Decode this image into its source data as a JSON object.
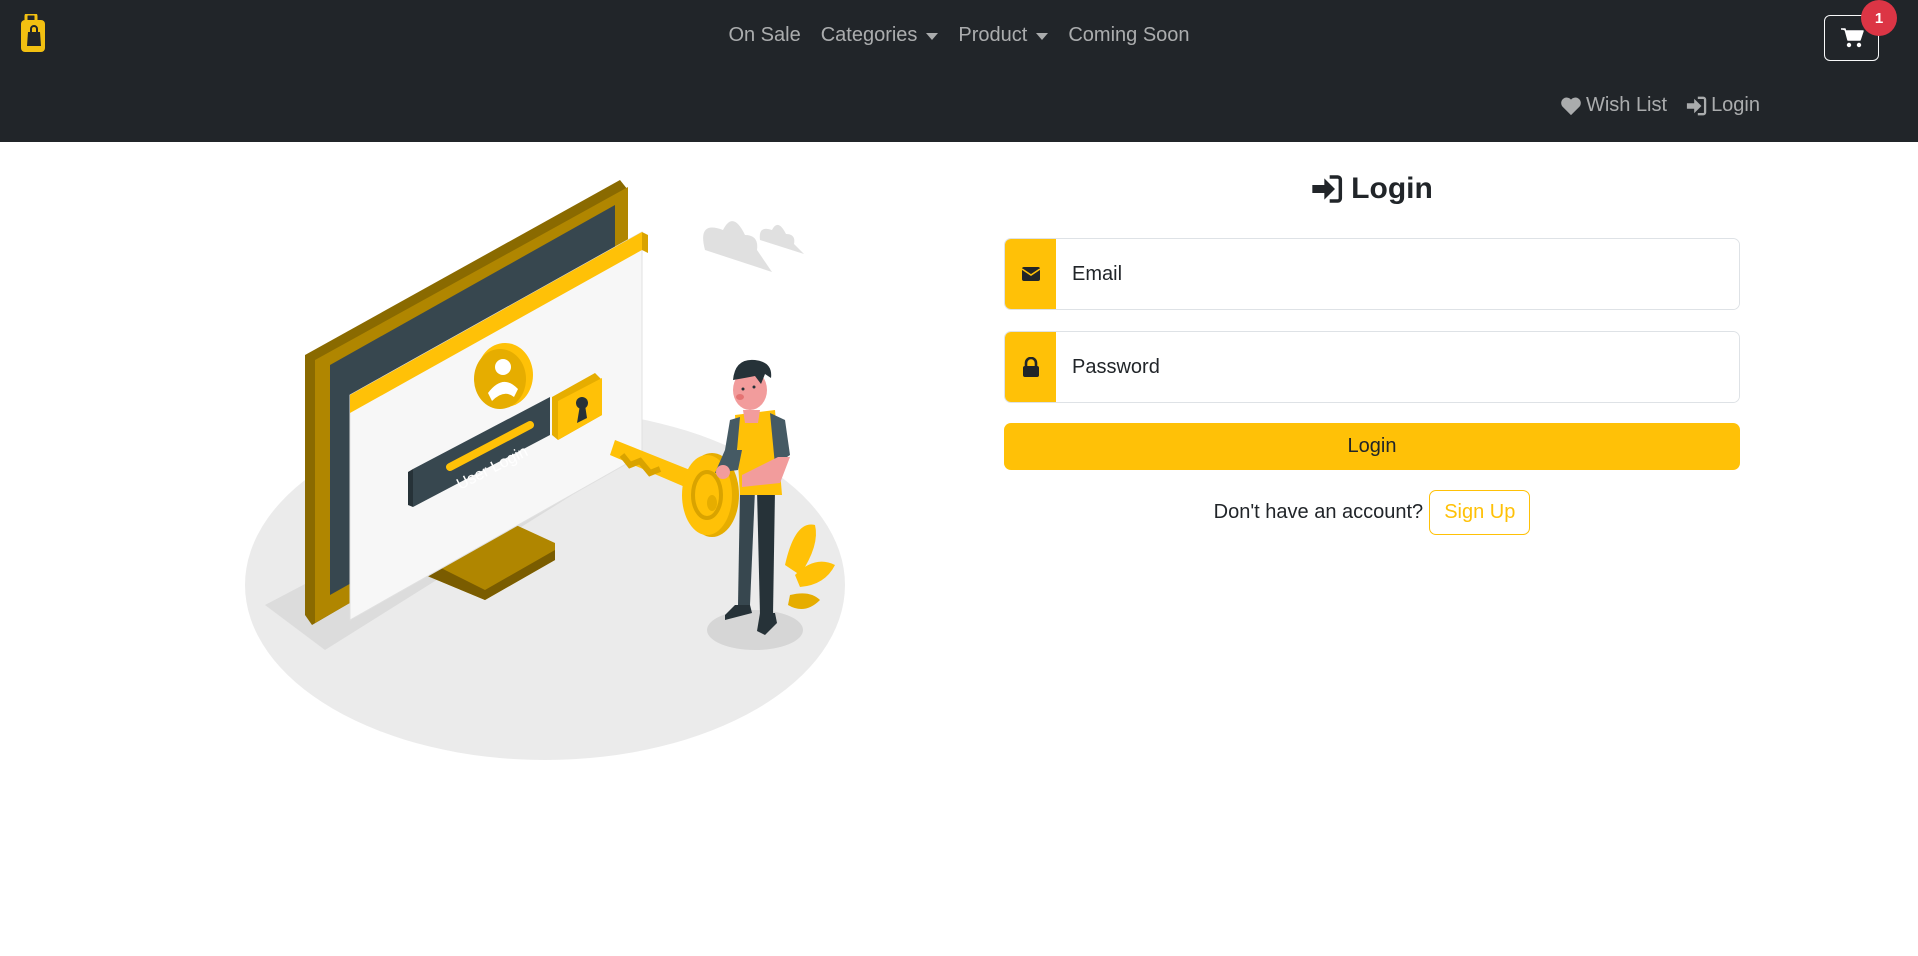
{
  "nav": {
    "items": [
      {
        "label": "On Sale"
      },
      {
        "label": "Categories"
      },
      {
        "label": "Product"
      },
      {
        "label": "Coming Soon"
      }
    ],
    "cart_count": "1",
    "wishlist_label": "Wish List",
    "login_label": "Login"
  },
  "illustration": {
    "screen_text": "User Login"
  },
  "login": {
    "title": "Login",
    "email_placeholder": "Email",
    "password_placeholder": "Password",
    "submit_label": "Login",
    "no_account_text": "Don't have an account?",
    "signup_label": "Sign Up"
  },
  "colors": {
    "navbar": "#212529",
    "accent": "#ffc107",
    "badge": "#dc3545"
  }
}
